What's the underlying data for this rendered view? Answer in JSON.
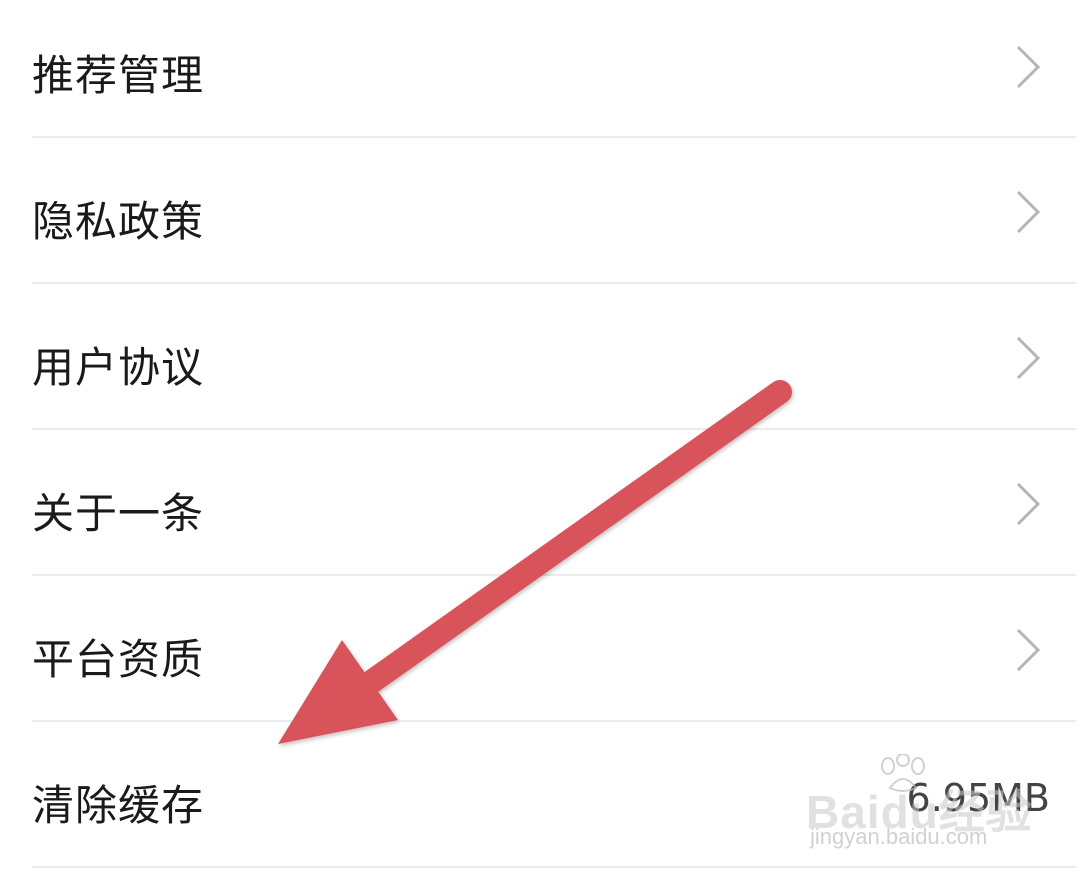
{
  "settings": {
    "items": [
      {
        "label": "推荐管理",
        "icon": "chevron-right-icon"
      },
      {
        "label": "隐私政策",
        "icon": "chevron-right-icon"
      },
      {
        "label": "用户协议",
        "icon": "chevron-right-icon"
      },
      {
        "label": "关于一条",
        "icon": "chevron-right-icon"
      },
      {
        "label": "平台资质",
        "icon": "chevron-right-icon"
      },
      {
        "label": "清除缓存",
        "value": "6.95MB"
      }
    ]
  },
  "annotation": {
    "type": "arrow",
    "color": "#d9535a",
    "points_to": "清除缓存"
  },
  "watermark": {
    "text": "Baidu经验",
    "url_text": "jingyan.baidu.com"
  }
}
